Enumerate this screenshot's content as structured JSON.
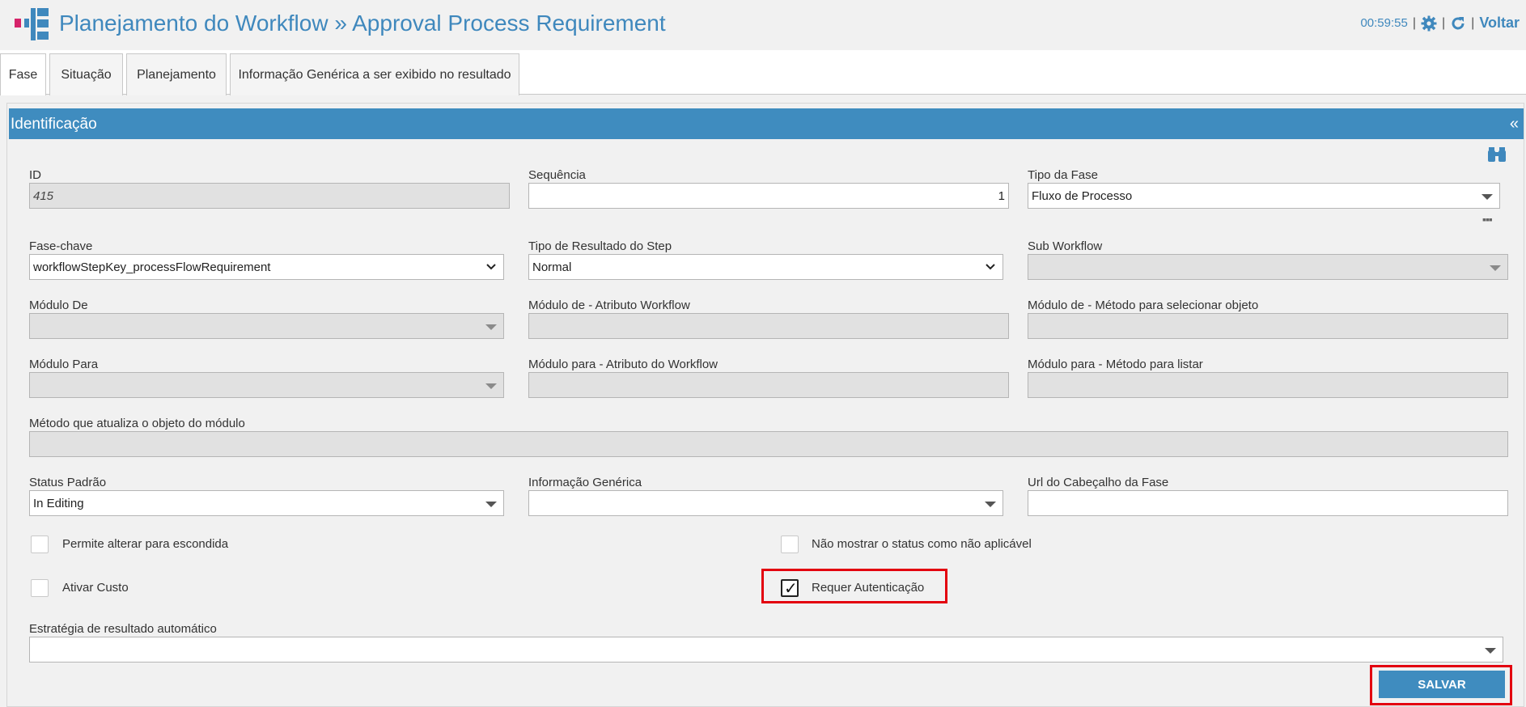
{
  "header": {
    "title": "Planejamento do Workflow » Approval Process Requirement",
    "time": "00:59:55",
    "separator": "|",
    "back_label": "Voltar",
    "accent_color": "#3f88bd",
    "logo_icon": "workflow-tree-icon"
  },
  "tabs": [
    {
      "label": "Fase",
      "active": true
    },
    {
      "label": "Situação",
      "active": false
    },
    {
      "label": "Planejamento",
      "active": false
    },
    {
      "label": "Informação Genérica a ser exibido no resultado",
      "active": false
    }
  ],
  "panel": {
    "title": "Identificação",
    "collapse": "«",
    "header_color": "#3f8cbf"
  },
  "form": {
    "id": {
      "label": "ID",
      "value": "415"
    },
    "sequencia": {
      "label": "Sequência",
      "value": "1"
    },
    "tipo_fase": {
      "label": "Tipo da Fase",
      "value": "Fluxo de Processo"
    },
    "fase_chave": {
      "label": "Fase-chave",
      "value": "workflowStepKey_processFlowRequirement"
    },
    "tipo_resultado": {
      "label": "Tipo de Resultado do Step",
      "value": "Normal"
    },
    "sub_workflow": {
      "label": "Sub Workflow",
      "value": ""
    },
    "modulo_de": {
      "label": "Módulo De",
      "value": ""
    },
    "modulo_de_atributo": {
      "label": "Módulo de - Atributo Workflow",
      "value": ""
    },
    "modulo_de_metodo": {
      "label": "Módulo de - Método para selecionar objeto",
      "value": ""
    },
    "modulo_para": {
      "label": "Módulo Para",
      "value": ""
    },
    "modulo_para_atributo": {
      "label": "Módulo para - Atributo do Workflow",
      "value": ""
    },
    "modulo_para_metodo": {
      "label": "Módulo para - Método para listar",
      "value": ""
    },
    "metodo_atualiza": {
      "label": "Método que atualiza o objeto do módulo",
      "value": ""
    },
    "status_padrao": {
      "label": "Status Padrão",
      "value": "In Editing"
    },
    "info_generica": {
      "label": "Informação Genérica",
      "value": ""
    },
    "url_cabecalho": {
      "label": "Url do Cabeçalho da Fase",
      "value": ""
    },
    "estrategia": {
      "label": "Estratégia de resultado automático",
      "value": ""
    }
  },
  "checkboxes": {
    "permite_escondida": {
      "label": "Permite alterar para escondida",
      "checked": false
    },
    "nao_mostrar_status": {
      "label": "Não mostrar o status como não aplicável",
      "checked": false
    },
    "ativar_custo": {
      "label": "Ativar Custo",
      "checked": false
    },
    "requer_autenticacao": {
      "label": "Requer Autenticação",
      "checked": true,
      "mark": "✓"
    }
  },
  "actions": {
    "save_label": "SALVAR",
    "highlight_color": "#e3000f"
  }
}
